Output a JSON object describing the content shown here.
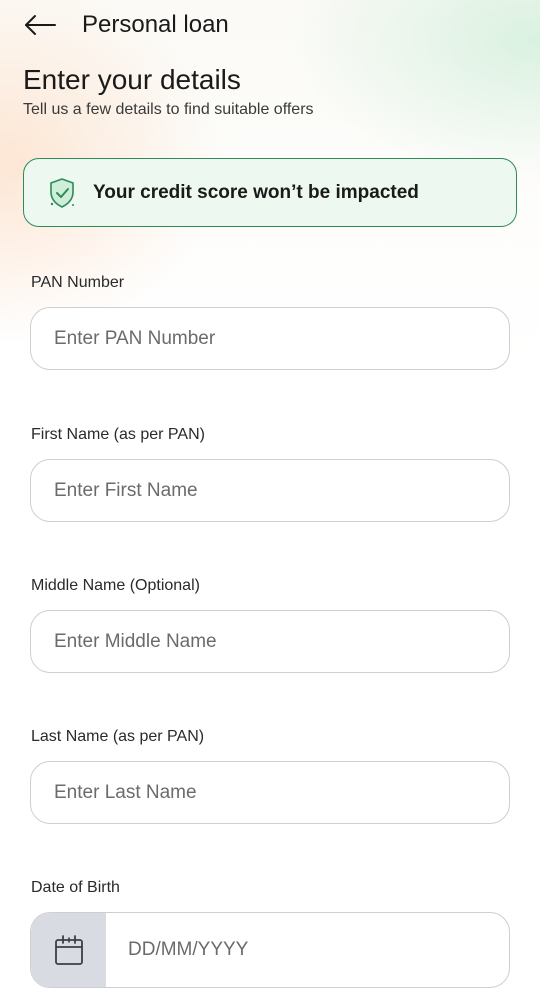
{
  "header": {
    "title": "Personal loan",
    "back_icon": "arrow-left-icon"
  },
  "intro": {
    "title": "Enter your details",
    "subtitle": "Tell us a few details  to find suitable offers"
  },
  "banner": {
    "icon": "shield-check-icon",
    "text": "Your credit score won’t be impacted",
    "accent_color": "#2f8a57"
  },
  "form": {
    "pan": {
      "label": "PAN Number",
      "placeholder": "Enter PAN Number",
      "value": ""
    },
    "first_name": {
      "label": "First Name (as per PAN)",
      "placeholder": "Enter First Name",
      "value": ""
    },
    "middle_name": {
      "label": "Middle Name (Optional)",
      "placeholder": "Enter Middle Name",
      "value": ""
    },
    "last_name": {
      "label": "Last Name (as per PAN)",
      "placeholder": "Enter Last Name",
      "value": ""
    },
    "dob": {
      "label": "Date of Birth",
      "placeholder": "DD/MM/YYYY",
      "value": "",
      "icon": "calendar-icon"
    }
  }
}
